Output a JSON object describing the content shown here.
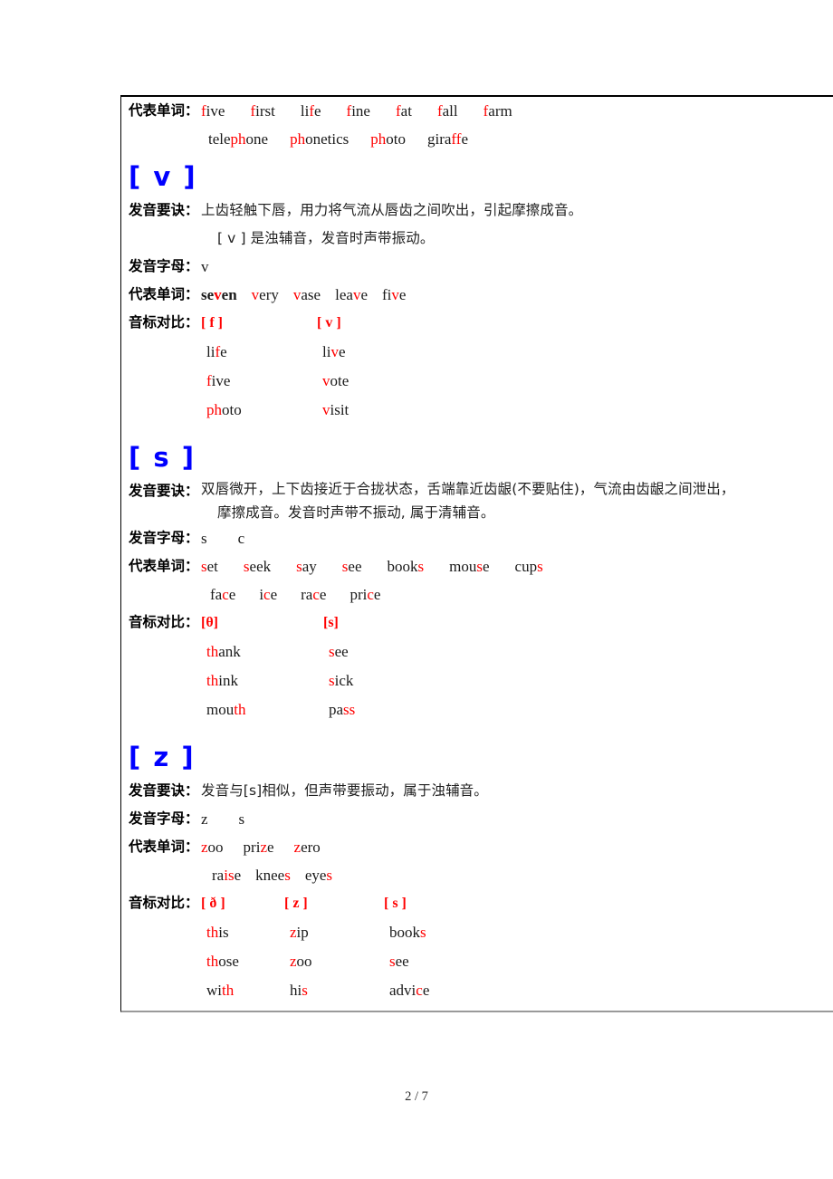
{
  "page": {
    "footer": "2 / 7"
  },
  "labels": {
    "pronunciation_tips": "发音要诀：",
    "letters": "发音字母：",
    "example_words": "代表单词：",
    "phonetic_comparison": "音标对比："
  },
  "sections": [
    {
      "id": "f-continued",
      "example_words_rows": [
        [
          {
            "parts": [
              {
                "t": "f",
                "c": "red"
              },
              {
                "t": "ive",
                "c": "black"
              }
            ]
          },
          {
            "parts": [
              {
                "t": "f",
                "c": "red"
              },
              {
                "t": "irst",
                "c": "black"
              }
            ]
          },
          {
            "parts": [
              {
                "t": "li",
                "c": "black"
              },
              {
                "t": "f",
                "c": "red"
              },
              {
                "t": "e",
                "c": "black"
              }
            ]
          },
          {
            "parts": [
              {
                "t": "f",
                "c": "red"
              },
              {
                "t": "ine",
                "c": "black"
              }
            ]
          },
          {
            "parts": [
              {
                "t": "f",
                "c": "red"
              },
              {
                "t": "at",
                "c": "black"
              }
            ]
          },
          {
            "parts": [
              {
                "t": "f",
                "c": "red"
              },
              {
                "t": "all",
                "c": "black"
              }
            ]
          },
          {
            "parts": [
              {
                "t": "f",
                "c": "red"
              },
              {
                "t": "arm",
                "c": "black"
              }
            ]
          }
        ],
        [
          {
            "parts": [
              {
                "t": "tele",
                "c": "black"
              },
              {
                "t": "ph",
                "c": "red"
              },
              {
                "t": "one",
                "c": "black"
              }
            ]
          },
          {
            "parts": [
              {
                "t": "ph",
                "c": "red"
              },
              {
                "t": "onetics",
                "c": "black"
              }
            ]
          },
          {
            "parts": [
              {
                "t": "ph",
                "c": "red"
              },
              {
                "t": "oto",
                "c": "black"
              }
            ]
          },
          {
            "parts": [
              {
                "t": "gira",
                "c": "black"
              },
              {
                "t": "ff",
                "c": "red"
              },
              {
                "t": "e",
                "c": "black"
              }
            ]
          }
        ]
      ]
    },
    {
      "id": "v",
      "phoneme": "[ v ]",
      "tips": [
        "上齿轻触下唇，用力将气流从唇齿之间吹出，引起摩擦成音。",
        "[ v ] 是浊辅音，发音时声带振动。"
      ],
      "letters": "v",
      "example_words_rows": [
        [
          {
            "bold": true,
            "parts": [
              {
                "t": "se",
                "c": "black"
              },
              {
                "t": "v",
                "c": "red"
              },
              {
                "t": "en",
                "c": "black"
              }
            ]
          },
          {
            "parts": [
              {
                "t": "v",
                "c": "red"
              },
              {
                "t": "ery",
                "c": "black"
              }
            ]
          },
          {
            "parts": [
              {
                "t": "v",
                "c": "red"
              },
              {
                "t": "ase",
                "c": "black"
              }
            ]
          },
          {
            "parts": [
              {
                "t": "lea",
                "c": "black"
              },
              {
                "t": "v",
                "c": "red"
              },
              {
                "t": "e",
                "c": "black"
              }
            ]
          },
          {
            "parts": [
              {
                "t": "fi",
                "c": "black"
              },
              {
                "t": "v",
                "c": "red"
              },
              {
                "t": "e",
                "c": "black"
              }
            ]
          }
        ]
      ],
      "comparison": {
        "headings": [
          "[ f ]",
          "[ v ]"
        ],
        "columns": [
          [
            {
              "parts": [
                {
                  "t": "li",
                  "c": "black"
                },
                {
                  "t": "f",
                  "c": "red"
                },
                {
                  "t": "e",
                  "c": "black"
                }
              ]
            },
            {
              "parts": [
                {
                  "t": "f",
                  "c": "red"
                },
                {
                  "t": "ive",
                  "c": "black"
                }
              ]
            },
            {
              "parts": [
                {
                  "t": "ph",
                  "c": "red"
                },
                {
                  "t": "oto",
                  "c": "black"
                }
              ]
            }
          ],
          [
            {
              "parts": [
                {
                  "t": "li",
                  "c": "black"
                },
                {
                  "t": "v",
                  "c": "red"
                },
                {
                  "t": "e",
                  "c": "black"
                }
              ]
            },
            {
              "parts": [
                {
                  "t": "v",
                  "c": "red"
                },
                {
                  "t": "ote",
                  "c": "black"
                }
              ]
            },
            {
              "parts": [
                {
                  "t": "v",
                  "c": "red"
                },
                {
                  "t": "isit",
                  "c": "black"
                }
              ]
            }
          ]
        ]
      }
    },
    {
      "id": "s",
      "phoneme": "[ s ]",
      "tips": [
        "双唇微开，上下齿接近于合拢状态，舌端靠近齿龈(不要贴住)，气流由齿龈之间泄出，",
        "摩擦成音。发音时声带不振动, 属于清辅音。"
      ],
      "letters": "s        c",
      "example_words_rows": [
        [
          {
            "parts": [
              {
                "t": "s",
                "c": "red"
              },
              {
                "t": "et",
                "c": "black"
              }
            ]
          },
          {
            "parts": [
              {
                "t": "s",
                "c": "red"
              },
              {
                "t": "eek",
                "c": "black"
              }
            ]
          },
          {
            "parts": [
              {
                "t": "s",
                "c": "red"
              },
              {
                "t": "ay",
                "c": "black"
              }
            ]
          },
          {
            "parts": [
              {
                "t": "s",
                "c": "red"
              },
              {
                "t": "ee",
                "c": "black"
              }
            ]
          },
          {
            "parts": [
              {
                "t": "book",
                "c": "black"
              },
              {
                "t": "s",
                "c": "red"
              }
            ]
          },
          {
            "parts": [
              {
                "t": "mou",
                "c": "black"
              },
              {
                "t": "s",
                "c": "red"
              },
              {
                "t": "e",
                "c": "black"
              }
            ]
          },
          {
            "parts": [
              {
                "t": "cup",
                "c": "black"
              },
              {
                "t": "s",
                "c": "red"
              }
            ]
          }
        ],
        [
          {
            "parts": [
              {
                "t": "fa",
                "c": "black"
              },
              {
                "t": "c",
                "c": "red"
              },
              {
                "t": "e",
                "c": "black"
              }
            ]
          },
          {
            "parts": [
              {
                "t": "i",
                "c": "black"
              },
              {
                "t": "c",
                "c": "red"
              },
              {
                "t": "e",
                "c": "black"
              }
            ]
          },
          {
            "parts": [
              {
                "t": "ra",
                "c": "black"
              },
              {
                "t": "c",
                "c": "red"
              },
              {
                "t": "e",
                "c": "black"
              }
            ]
          },
          {
            "parts": [
              {
                "t": "pri",
                "c": "black"
              },
              {
                "t": "c",
                "c": "red"
              },
              {
                "t": "e",
                "c": "black"
              }
            ]
          }
        ]
      ],
      "comparison": {
        "headings": [
          "[θ]",
          "[s]"
        ],
        "columns": [
          [
            {
              "parts": [
                {
                  "t": "th",
                  "c": "red"
                },
                {
                  "t": "ank",
                  "c": "black"
                }
              ]
            },
            {
              "parts": [
                {
                  "t": "th",
                  "c": "red"
                },
                {
                  "t": "ink",
                  "c": "black"
                }
              ]
            },
            {
              "parts": [
                {
                  "t": "mou",
                  "c": "black"
                },
                {
                  "t": "th",
                  "c": "red"
                }
              ]
            }
          ],
          [
            {
              "parts": [
                {
                  "t": "s",
                  "c": "red"
                },
                {
                  "t": "ee",
                  "c": "black"
                }
              ]
            },
            {
              "parts": [
                {
                  "t": "s",
                  "c": "red"
                },
                {
                  "t": "ick",
                  "c": "black"
                }
              ]
            },
            {
              "parts": [
                {
                  "t": "pa",
                  "c": "black"
                },
                {
                  "t": "ss",
                  "c": "red"
                }
              ]
            }
          ]
        ]
      }
    },
    {
      "id": "z",
      "phoneme": "[ z ]",
      "tips": [
        "发音与[s]相似，但声带要振动，属于浊辅音。"
      ],
      "letters": "z        s",
      "example_words_rows": [
        [
          {
            "parts": [
              {
                "t": "z",
                "c": "red"
              },
              {
                "t": "oo",
                "c": "black"
              }
            ]
          },
          {
            "parts": [
              {
                "t": "pri",
                "c": "black"
              },
              {
                "t": "z",
                "c": "red"
              },
              {
                "t": "e",
                "c": "black"
              }
            ]
          },
          {
            "parts": [
              {
                "t": "z",
                "c": "red"
              },
              {
                "t": "ero",
                "c": "black"
              }
            ]
          }
        ],
        [
          {
            "parts": [
              {
                "t": "ra",
                "c": "black"
              },
              {
                "t": "is",
                "c": "red"
              },
              {
                "t": "e",
                "c": "black"
              }
            ]
          },
          {
            "parts": [
              {
                "t": "knee",
                "c": "black"
              },
              {
                "t": "s",
                "c": "red"
              }
            ]
          },
          {
            "parts": [
              {
                "t": "eye",
                "c": "black"
              },
              {
                "t": "s",
                "c": "red"
              }
            ]
          }
        ]
      ],
      "comparison": {
        "headings": [
          "[ ð ]",
          "[ z ]",
          "[ s ]"
        ],
        "columns": [
          [
            {
              "parts": [
                {
                  "t": "th",
                  "c": "red"
                },
                {
                  "t": "is",
                  "c": "black"
                }
              ]
            },
            {
              "parts": [
                {
                  "t": "th",
                  "c": "red"
                },
                {
                  "t": "ose",
                  "c": "black"
                }
              ]
            },
            {
              "parts": [
                {
                  "t": "wi",
                  "c": "black"
                },
                {
                  "t": "th",
                  "c": "red"
                }
              ]
            }
          ],
          [
            {
              "parts": [
                {
                  "t": "z",
                  "c": "red"
                },
                {
                  "t": "ip",
                  "c": "black"
                }
              ]
            },
            {
              "parts": [
                {
                  "t": "z",
                  "c": "red"
                },
                {
                  "t": "oo",
                  "c": "black"
                }
              ]
            },
            {
              "parts": [
                {
                  "t": "hi",
                  "c": "black"
                },
                {
                  "t": "s",
                  "c": "red"
                }
              ]
            }
          ],
          [
            {
              "parts": [
                {
                  "t": "book",
                  "c": "black"
                },
                {
                  "t": "s",
                  "c": "red"
                }
              ]
            },
            {
              "parts": [
                {
                  "t": "s",
                  "c": "red"
                },
                {
                  "t": "ee",
                  "c": "black"
                }
              ]
            },
            {
              "parts": [
                {
                  "t": "advi",
                  "c": "black"
                },
                {
                  "t": "c",
                  "c": "red"
                },
                {
                  "t": "e",
                  "c": "black"
                }
              ]
            }
          ]
        ]
      }
    }
  ],
  "colors": {
    "highlight": "#ff0000",
    "phoneme": "#0000ff",
    "text": "#1a1a1a"
  }
}
